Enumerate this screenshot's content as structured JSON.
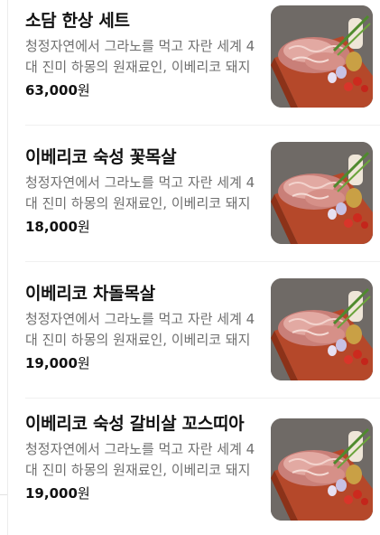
{
  "menu": {
    "items": [
      {
        "name": "소담 한상 세트",
        "description": "청정자연에서 그라노를 먹고 자란 세계 4대 진미 하몽의 원재료인, 이베리코 돼지",
        "price": "63,000",
        "currency": "원",
        "image": "pork-platter-photo"
      },
      {
        "name": "이베리코 숙성 꽃목살",
        "description": "청정자연에서 그라노를 먹고 자란 세계 4대 진미 하몽의 원재료인, 이베리코 돼지",
        "price": "18,000",
        "currency": "원",
        "image": "pork-platter-photo"
      },
      {
        "name": "이베리코 차돌목살",
        "description": "청정자연에서 그라노를 먹고 자란 세계 4대 진미 하몽의 원재료인, 이베리코 돼지",
        "price": "19,000",
        "currency": "원",
        "image": "pork-platter-photo"
      },
      {
        "name": "이베리코 숙성 갈비살 꼬스띠아",
        "description": "청정자연에서 그라노를 먹고 자란 세계 4대 진미 하몽의 원재료인, 이베리코 돼지",
        "price": "19,000",
        "currency": "원",
        "image": "pork-platter-photo"
      }
    ]
  }
}
